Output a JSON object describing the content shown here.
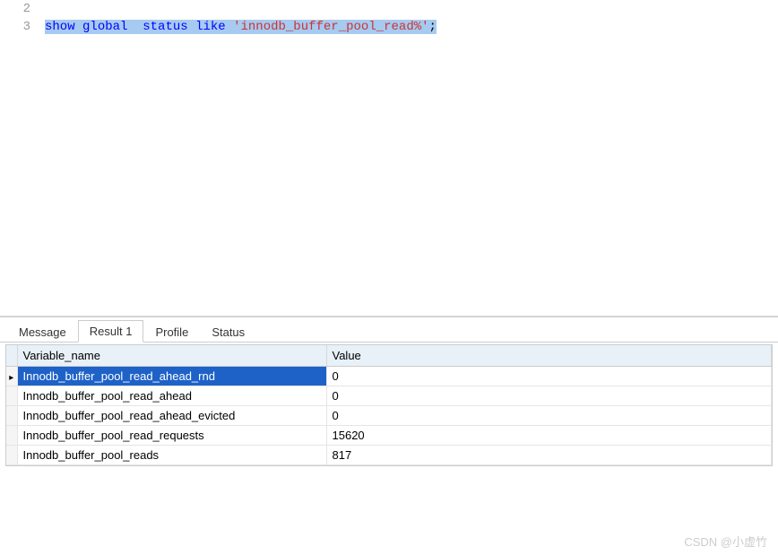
{
  "editor": {
    "lines": [
      {
        "num": "2",
        "segments": []
      },
      {
        "num": "3",
        "segments": [
          {
            "text": "show",
            "cls": "kw-blue",
            "sel": true
          },
          {
            "text": " ",
            "cls": "plain-black",
            "sel": true
          },
          {
            "text": "global",
            "cls": "kw-blue",
            "sel": true
          },
          {
            "text": "  ",
            "cls": "plain-black",
            "sel": true
          },
          {
            "text": "status",
            "cls": "kw-blue",
            "sel": true
          },
          {
            "text": " ",
            "cls": "plain-black",
            "sel": true
          },
          {
            "text": "like",
            "cls": "kw-blue",
            "sel": true
          },
          {
            "text": " ",
            "cls": "plain-black",
            "sel": true
          },
          {
            "text": "'innodb_buffer_pool_read%'",
            "cls": "str-red",
            "sel": true
          },
          {
            "text": ";",
            "cls": "plain-black",
            "sel": true
          }
        ]
      }
    ]
  },
  "tabs": {
    "items": [
      {
        "label": "Message",
        "active": false
      },
      {
        "label": "Result 1",
        "active": true
      },
      {
        "label": "Profile",
        "active": false
      },
      {
        "label": "Status",
        "active": false
      }
    ]
  },
  "results": {
    "headers": {
      "col1": "Variable_name",
      "col2": "Value"
    },
    "rows": [
      {
        "name": "Innodb_buffer_pool_read_ahead_rnd",
        "value": "0",
        "selected": true
      },
      {
        "name": "Innodb_buffer_pool_read_ahead",
        "value": "0",
        "selected": false
      },
      {
        "name": "Innodb_buffer_pool_read_ahead_evicted",
        "value": "0",
        "selected": false
      },
      {
        "name": "Innodb_buffer_pool_read_requests",
        "value": "15620",
        "selected": false
      },
      {
        "name": "Innodb_buffer_pool_reads",
        "value": "817",
        "selected": false
      }
    ]
  },
  "watermark": "CSDN @小虚竹"
}
